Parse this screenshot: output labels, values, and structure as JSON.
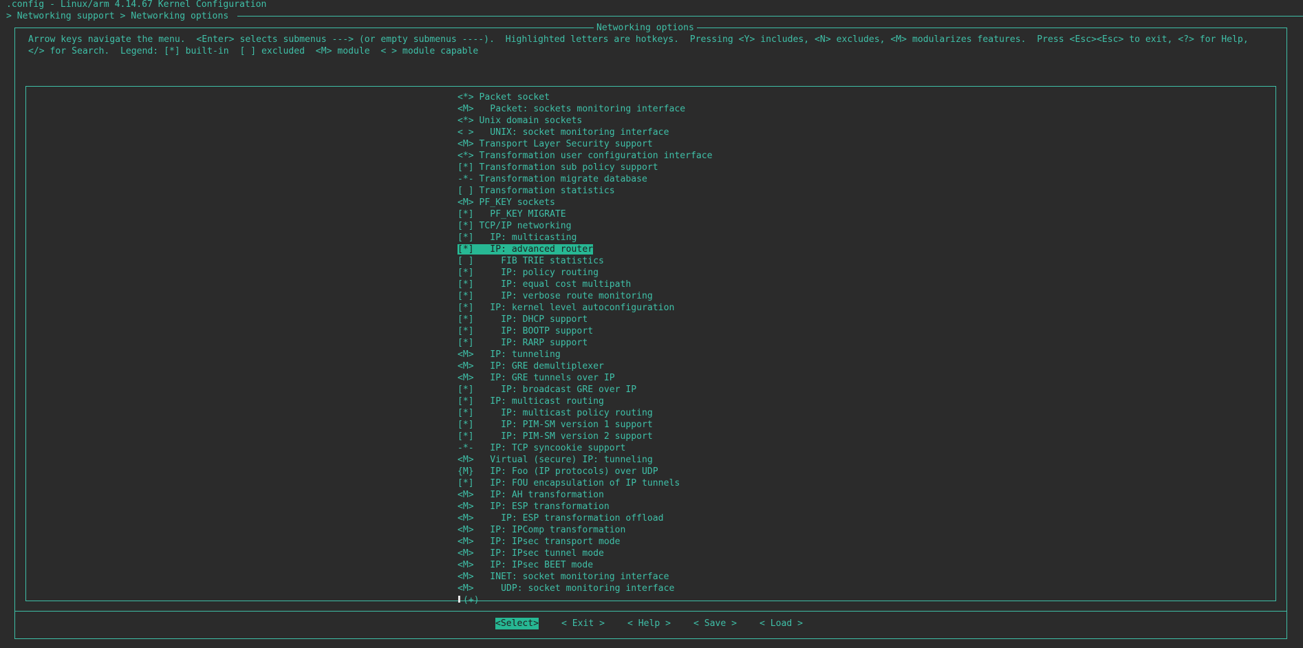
{
  "header": {
    "title": ".config - Linux/arm 4.14.67 Kernel Configuration",
    "breadcrumb": "> Networking support > Networking options"
  },
  "dialog": {
    "title": "Networking options",
    "help_line1": "Arrow keys navigate the menu.  <Enter> selects submenus ---> (or empty submenus ----).  Highlighted letters are hotkeys.  Pressing <Y> includes, <N> excludes, <M> modularizes features.  Press <Esc><Esc> to exit, <?> for Help,",
    "help_line2": "</> for Search.  Legend: [*] built-in  [ ] excluded  <M> module  < > module capable"
  },
  "menu": {
    "items": [
      {
        "sym": "<*>",
        "label": " Packet socket"
      },
      {
        "sym": "<M>",
        "label": "   Packet: sockets monitoring interface"
      },
      {
        "sym": "<*>",
        "label": " Unix domain sockets"
      },
      {
        "sym": "< >",
        "label": "   UNIX: socket monitoring interface"
      },
      {
        "sym": "<M>",
        "label": " Transport Layer Security support"
      },
      {
        "sym": "<*>",
        "label": " Transformation user configuration interface"
      },
      {
        "sym": "[*]",
        "label": " Transformation sub policy support"
      },
      {
        "sym": "-*-",
        "label": " Transformation migrate database"
      },
      {
        "sym": "[ ]",
        "label": " Transformation statistics"
      },
      {
        "sym": "<M>",
        "label": " PF_KEY sockets"
      },
      {
        "sym": "[*]",
        "label": "   PF_KEY MIGRATE"
      },
      {
        "sym": "[*]",
        "label": " TCP/IP networking"
      },
      {
        "sym": "[*]",
        "label": "   IP: multicasting"
      },
      {
        "sym": "[*]",
        "label": "   IP: advanced router"
      },
      {
        "sym": "[ ]",
        "label": "     FIB TRIE statistics"
      },
      {
        "sym": "[*]",
        "label": "     IP: policy routing"
      },
      {
        "sym": "[*]",
        "label": "     IP: equal cost multipath"
      },
      {
        "sym": "[*]",
        "label": "     IP: verbose route monitoring"
      },
      {
        "sym": "[*]",
        "label": "   IP: kernel level autoconfiguration"
      },
      {
        "sym": "[*]",
        "label": "     IP: DHCP support"
      },
      {
        "sym": "[*]",
        "label": "     IP: BOOTP support"
      },
      {
        "sym": "[*]",
        "label": "     IP: RARP support"
      },
      {
        "sym": "<M>",
        "label": "   IP: tunneling"
      },
      {
        "sym": "<M>",
        "label": "   IP: GRE demultiplexer"
      },
      {
        "sym": "<M>",
        "label": "   IP: GRE tunnels over IP"
      },
      {
        "sym": "[*]",
        "label": "     IP: broadcast GRE over IP"
      },
      {
        "sym": "[*]",
        "label": "   IP: multicast routing"
      },
      {
        "sym": "[*]",
        "label": "     IP: multicast policy routing"
      },
      {
        "sym": "[*]",
        "label": "     IP: PIM-SM version 1 support"
      },
      {
        "sym": "[*]",
        "label": "     IP: PIM-SM version 2 support"
      },
      {
        "sym": "-*-",
        "label": "   IP: TCP syncookie support"
      },
      {
        "sym": "<M>",
        "label": "   Virtual (secure) IP: tunneling"
      },
      {
        "sym": "{M}",
        "label": "   IP: Foo (IP protocols) over UDP"
      },
      {
        "sym": "[*]",
        "label": "   IP: FOU encapsulation of IP tunnels"
      },
      {
        "sym": "<M>",
        "label": "   IP: AH transformation"
      },
      {
        "sym": "<M>",
        "label": "   IP: ESP transformation"
      },
      {
        "sym": "<M>",
        "label": "     IP: ESP transformation offload"
      },
      {
        "sym": "<M>",
        "label": "   IP: IPComp transformation"
      },
      {
        "sym": "<M>",
        "label": "   IP: IPsec transport mode"
      },
      {
        "sym": "<M>",
        "label": "   IP: IPsec tunnel mode"
      },
      {
        "sym": "<M>",
        "label": "   IP: IPsec BEET mode"
      },
      {
        "sym": "<M>",
        "label": "   INET: socket monitoring interface"
      },
      {
        "sym": "<M>",
        "label": "     UDP: socket monitoring interface"
      }
    ],
    "selected_index": 13,
    "more_indicator": "(+)"
  },
  "buttons": {
    "select": "<Select>",
    "exit": "< Exit >",
    "help": "< Help >",
    "save": "< Save >",
    "load": "< Load >"
  },
  "colors": {
    "background": "#2b2b2b",
    "foreground": "#3fc0a8",
    "highlight": "#27b894"
  }
}
